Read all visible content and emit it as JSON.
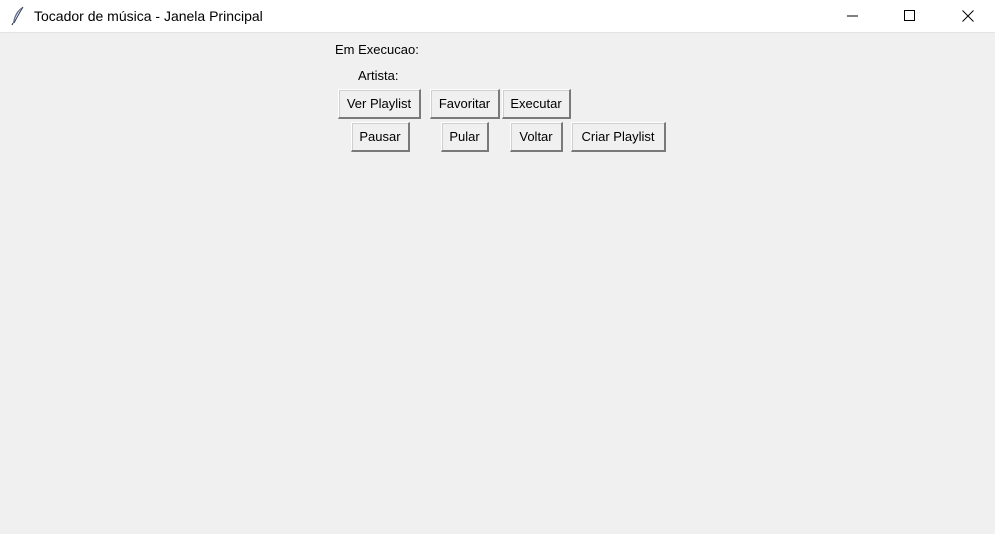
{
  "window": {
    "title": "Tocador de música - Janela Principal",
    "icon": "feather-icon",
    "controls": [
      "minimize-icon",
      "maximize-icon",
      "close-icon"
    ]
  },
  "labels": {
    "now_playing": "Em Execucao:",
    "artist": "Artista:"
  },
  "buttons": {
    "row1": [
      "Ver Playlist",
      "Favoritar",
      "Executar"
    ],
    "row2": [
      "Pausar",
      "Pular",
      "Voltar",
      "Criar Playlist"
    ]
  },
  "colors": {
    "background": "#f0f0f0",
    "titlebar": "#ffffff"
  }
}
